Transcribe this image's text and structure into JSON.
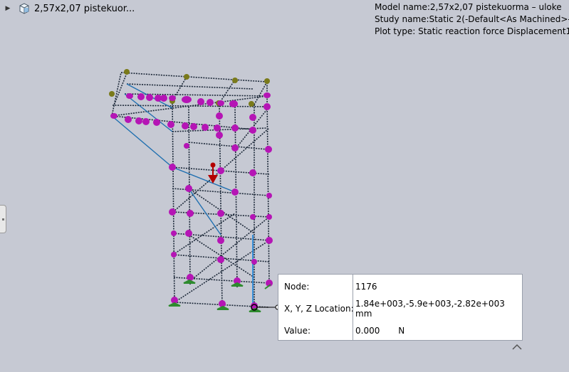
{
  "tree": {
    "part_name": "2,57x2,07 pistekuor..."
  },
  "info": {
    "model_line": "Model name:2,57x2,07 pistekuorma – uloke",
    "study_line": "Study name:Static 2(-Default<As Machined>-)",
    "plot_line": "Plot type: Static reaction force Displacement1"
  },
  "probe": {
    "node_label": "Node:",
    "node_value": "1176",
    "location_label": "X, Y, Z Location:",
    "location_value": "1.84e+003,-5.9e+003,-2.82e+003 mm",
    "value_label": "Value:",
    "value_value": "0.000",
    "value_unit": "N"
  },
  "colors": {
    "background": "#c6c9d3",
    "beam": "#1e2a3a",
    "joint": "#b515b5",
    "selected_beam": "#1f88c8",
    "load_arrow": "#b30000",
    "fixture": "#2e8b2e",
    "top_node": "#7a7a1a"
  },
  "icons": [
    "expand-arrow-icon",
    "part-icon",
    "panel-handle-icon",
    "collapse-chevron-icon"
  ]
}
